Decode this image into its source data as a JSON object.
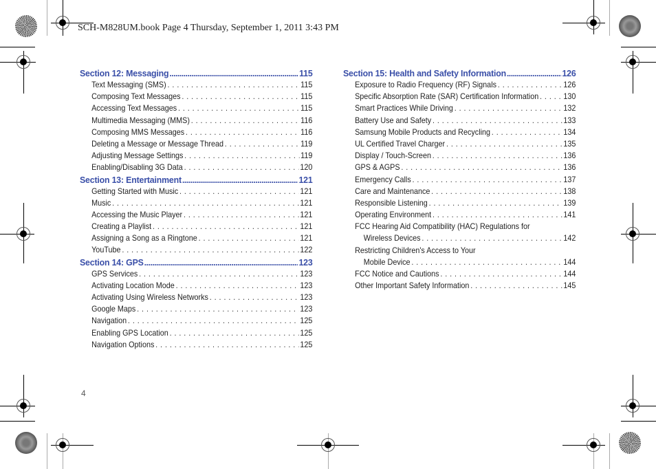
{
  "header": {
    "slug": "SCH-M828UM.book  Page 4  Thursday, September 1, 2011  3:43 PM"
  },
  "folio": "4",
  "toc": {
    "left": [
      {
        "title": "Section 12:  Messaging",
        "page": "115",
        "items": [
          {
            "label": "Text Messaging (SMS)",
            "page": "115"
          },
          {
            "label": "Composing Text Messages",
            "page": "115"
          },
          {
            "label": "Accessing Text Messages",
            "page": "115"
          },
          {
            "label": "Multimedia Messaging (MMS)",
            "page": "116"
          },
          {
            "label": "Composing MMS Messages",
            "page": "116"
          },
          {
            "label": "Deleting a Message or Message Thread",
            "page": "119"
          },
          {
            "label": "Adjusting Message Settings",
            "page": "119"
          },
          {
            "label": "Enabling/Disabling 3G Data",
            "page": "120"
          }
        ]
      },
      {
        "title": "Section 13:  Entertainment",
        "page": "121",
        "items": [
          {
            "label": "Getting Started with Music",
            "page": "121"
          },
          {
            "label": "Music",
            "page": "121"
          },
          {
            "label": "Accessing the Music Player",
            "page": "121"
          },
          {
            "label": "Creating a Playlist",
            "page": "121"
          },
          {
            "label": "Assigning a Song as a Ringtone",
            "page": "121"
          },
          {
            "label": "YouTube",
            "page": "122"
          }
        ]
      },
      {
        "title": "Section 14:  GPS",
        "page": "123",
        "items": [
          {
            "label": "GPS Services",
            "page": "123"
          },
          {
            "label": "Activating Location Mode",
            "page": "123"
          },
          {
            "label": "Activating Using Wireless Networks",
            "page": "123"
          },
          {
            "label": "Google Maps",
            "page": "123"
          },
          {
            "label": "Navigation",
            "page": "125"
          },
          {
            "label": "Enabling GPS Location",
            "page": "125"
          },
          {
            "label": "Navigation Options",
            "page": "125"
          }
        ]
      }
    ],
    "right": [
      {
        "title": "Section 15:  Health and Safety Information",
        "page": "126",
        "items": [
          {
            "label": "Exposure to Radio Frequency (RF) Signals",
            "page": "126"
          },
          {
            "label": "Specific Absorption Rate (SAR) Certification Information",
            "page": "130"
          },
          {
            "label": "Smart Practices While Driving",
            "page": "132"
          },
          {
            "label": "Battery Use and Safety",
            "page": "133"
          },
          {
            "label": "Samsung Mobile Products and Recycling",
            "page": "134"
          },
          {
            "label": "UL Certified Travel Charger",
            "page": "135"
          },
          {
            "label": "Display / Touch-Screen",
            "page": "136"
          },
          {
            "label": "GPS & AGPS",
            "page": "136"
          },
          {
            "label": "Emergency Calls",
            "page": "137"
          },
          {
            "label": "Care and Maintenance",
            "page": "138"
          },
          {
            "label": "Responsible Listening",
            "page": "139"
          },
          {
            "label": "Operating Environment",
            "page": "141"
          },
          {
            "label": "FCC Hearing Aid Compatibility (HAC) Regulations for",
            "continuation": "Wireless Devices",
            "page": "142"
          },
          {
            "label": "Restricting Children's Access to Your",
            "continuation": "Mobile Device",
            "page": "144"
          },
          {
            "label": "FCC Notice and Cautions",
            "page": "144"
          },
          {
            "label": "Other Important Safety Information",
            "page": "145"
          }
        ]
      }
    ]
  },
  "colors": {
    "section_heading": "#3a4fa8",
    "body_text": "#222222"
  }
}
